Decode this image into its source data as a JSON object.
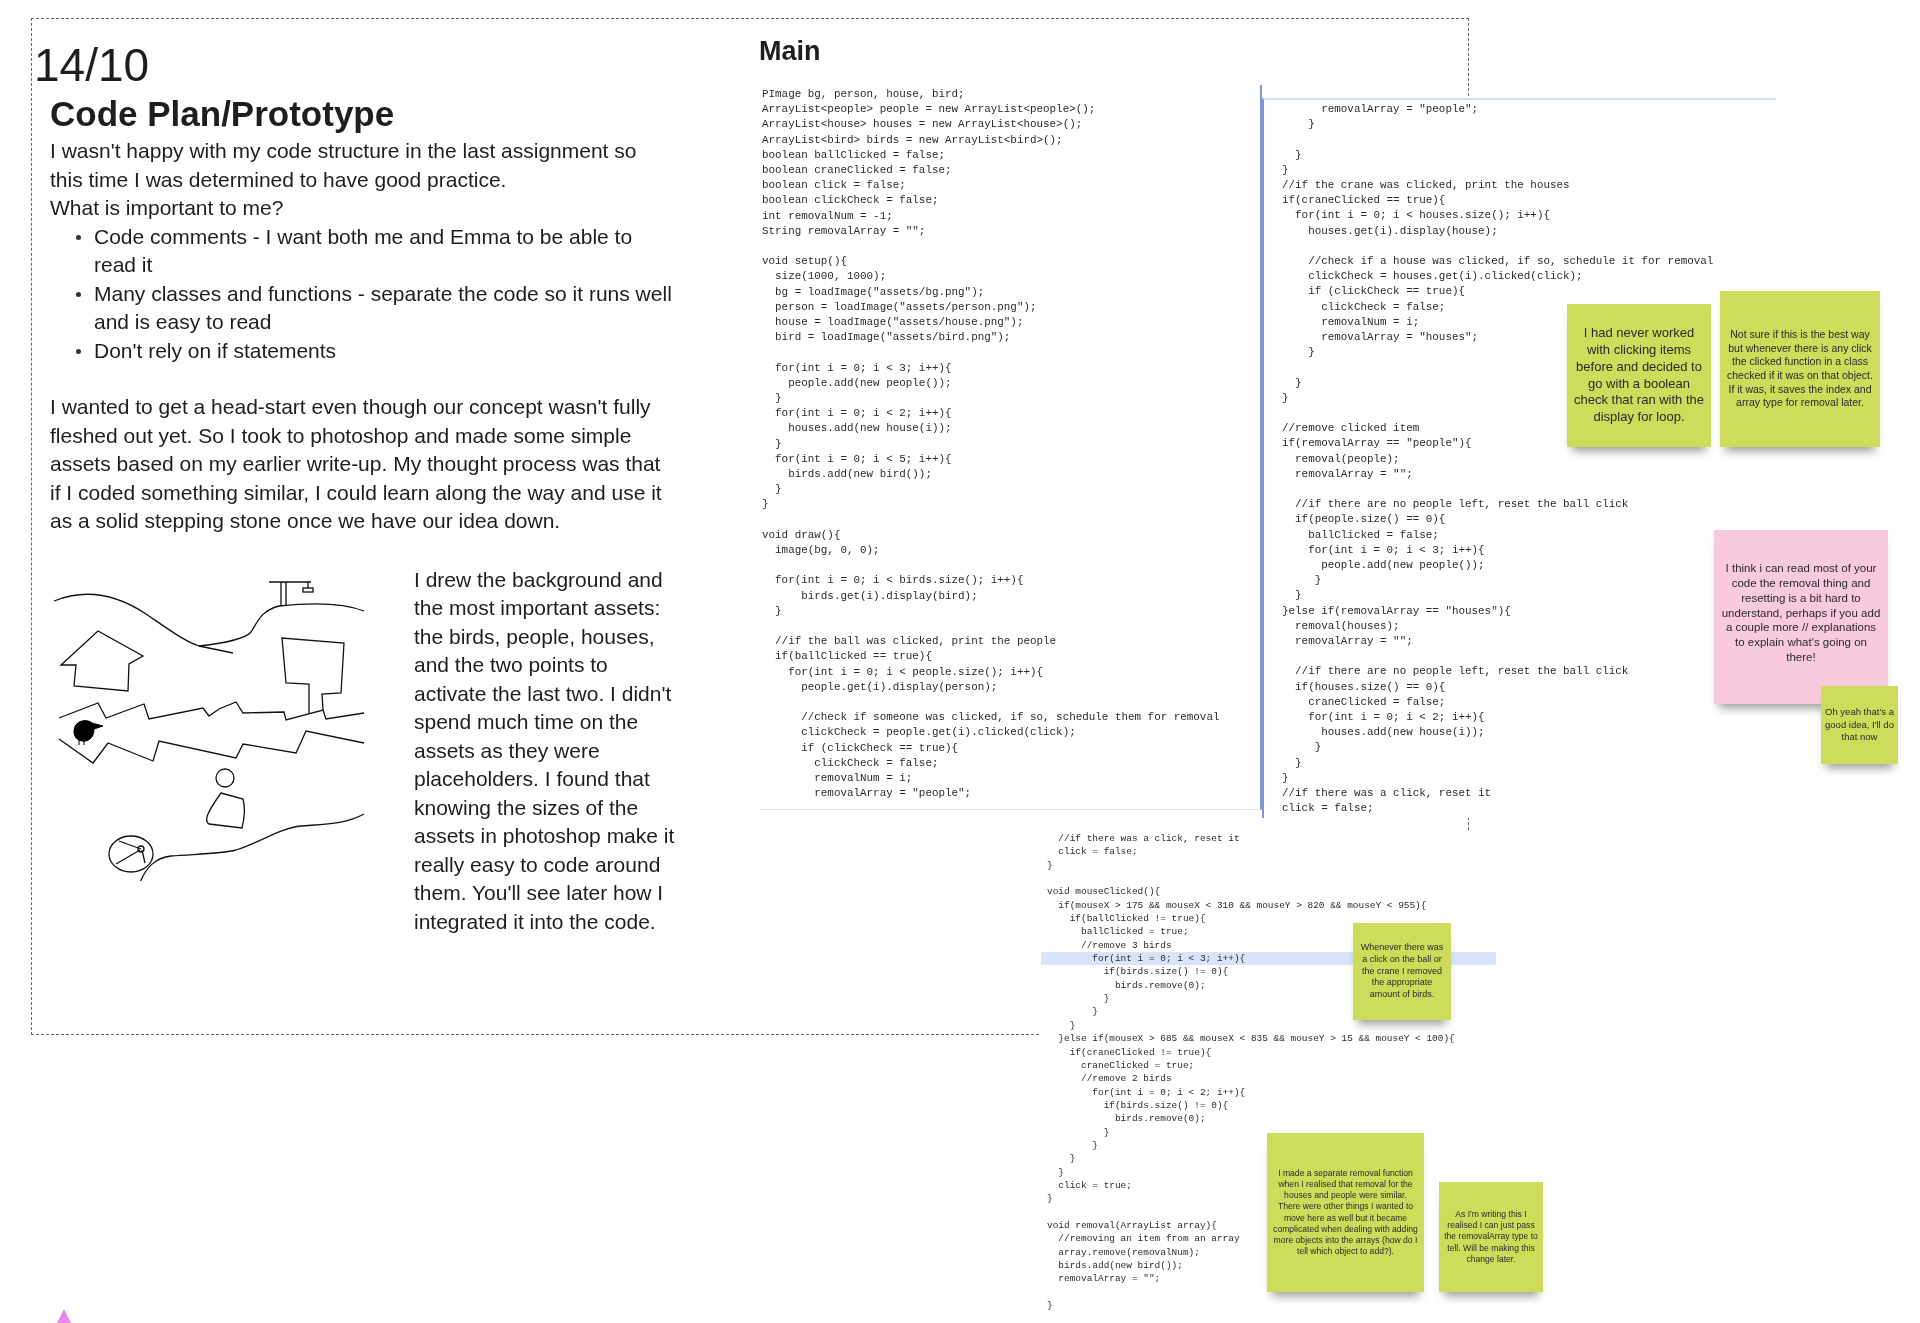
{
  "board": {
    "date": "14/10",
    "title": "Code Plan/Prototype",
    "intro": [
      "I wasn't happy with my code structure in the last assignment so this time I was determined to have good practice.",
      "What is important to me?"
    ],
    "bullets": [
      "Code comments - I want both me and Emma to be able to read it",
      "Many classes and functions - separate the code so it runs well and is easy to read",
      "Don't rely on if statements"
    ],
    "paragraph": "I wanted to get a head-start even though our concept wasn't fully fleshed out yet. So I took to photoshop and made some simple assets based on my earlier write-up. My thought process was that if I coded something similar, I could learn along the way and use it as a solid stepping stone once we have our idea down.",
    "sketch_caption": "I drew the background and the most important assets: the birds, people, houses, and the two points to activate the last two. I didn't spend much time on the assets as they were placeholders. I found that knowing the sizes of the assets in photoshop make it really easy to code around them. You'll see later how I integrated it into the code."
  },
  "code_section": {
    "heading": "Main",
    "blocks": [
      {
        "chunks": [
          {
            "gap_before": false,
            "highlighted": false,
            "lines": [
              "PImage bg, person, house, bird;",
              "ArrayList<people> people = new ArrayList<people>();",
              "ArrayList<house> houses = new ArrayList<house>();",
              "ArrayList<bird> birds = new ArrayList<bird>();",
              "boolean ballClicked = false;",
              "boolean craneClicked = false;",
              "boolean click = false;",
              "boolean clickCheck = false;",
              "int removalNum = -1;",
              "String removalArray = \"\";"
            ]
          },
          {
            "gap_before": true,
            "highlighted": false,
            "lines": [
              "void setup(){",
              "  size(1000, 1000);",
              "  bg = loadImage(\"assets/bg.png\");",
              "  person = loadImage(\"assets/person.png\");",
              "  house = loadImage(\"assets/house.png\");",
              "  bird = loadImage(\"assets/bird.png\");"
            ]
          },
          {
            "gap_before": true,
            "highlighted": false,
            "lines": [
              "  for(int i = 0; i < 3; i++){",
              "    people.add(new people());",
              "  }",
              "  for(int i = 0; i < 2; i++){",
              "    houses.add(new house(i));",
              "  }",
              "  for(int i = 0; i < 5; i++){",
              "    birds.add(new bird());",
              "  }",
              "}"
            ]
          },
          {
            "gap_before": true,
            "highlighted": false,
            "lines": [
              "void draw(){",
              "  image(bg, 0, 0);"
            ]
          },
          {
            "gap_before": true,
            "highlighted": false,
            "lines": [
              "  for(int i = 0; i < birds.size(); i++){",
              "      birds.get(i).display(bird);",
              "  }"
            ]
          },
          {
            "gap_before": true,
            "highlighted": false,
            "lines": [
              "  //if the ball was clicked, print the people",
              "  if(ballClicked == true){",
              "    for(int i = 0; i < people.size(); i++){",
              "      people.get(i).display(person);"
            ]
          },
          {
            "gap_before": true,
            "highlighted": false,
            "lines": [
              "      //check if someone was clicked, if so, schedule them for removal",
              "      clickCheck = people.get(i).clicked(click);",
              "      if (clickCheck == true){",
              "        clickCheck = false;",
              "        removalNum = i;",
              "        removalArray = \"people\";"
            ]
          }
        ]
      },
      {
        "chunks": [
          {
            "gap_before": false,
            "highlighted": false,
            "lines": [
              "      removalArray = \"people\";",
              "    }"
            ]
          },
          {
            "gap_before": true,
            "highlighted": false,
            "lines": [
              "  }",
              "}",
              "//if the crane was clicked, print the houses",
              "if(craneClicked == true){",
              "  for(int i = 0; i < houses.size(); i++){",
              "    houses.get(i).display(house);"
            ]
          },
          {
            "gap_before": true,
            "highlighted": false,
            "lines": [
              "    //check if a house was clicked, if so, schedule it for removal",
              "    clickCheck = houses.get(i).clicked(click);",
              "    if (clickCheck == true){",
              "      clickCheck = false;",
              "      removalNum = i;",
              "      removalArray = \"houses\";",
              "    }"
            ]
          },
          {
            "gap_before": true,
            "highlighted": false,
            "lines": [
              "  }",
              "}"
            ]
          },
          {
            "gap_before": true,
            "highlighted": false,
            "lines": [
              "//remove clicked item",
              "if(removalArray == \"people\"){",
              "  removal(people);",
              "  removalArray = \"\";"
            ]
          },
          {
            "gap_before": true,
            "highlighted": false,
            "lines": [
              "  //if there are no people left, reset the ball click",
              "  if(people.size() == 0){",
              "    ballClicked = false;",
              "    for(int i = 0; i < 3; i++){",
              "      people.add(new people());",
              "     }",
              "  }",
              "}else if(removalArray == \"houses\"){",
              "  removal(houses);",
              "  removalArray = \"\";"
            ]
          },
          {
            "gap_before": true,
            "highlighted": false,
            "lines": [
              "  //if there are no people left, reset the ball click",
              "  if(houses.size() == 0){",
              "    craneClicked = false;",
              "    for(int i = 0; i < 2; i++){",
              "      houses.add(new house(i));",
              "     }",
              "  }",
              "}",
              "//if there was a click, reset it",
              "click = false;"
            ]
          }
        ]
      },
      {
        "chunks": [
          {
            "gap_before": false,
            "highlighted": false,
            "lines": [
              "  //if there was a click, reset it",
              "  click = false;",
              "}"
            ]
          },
          {
            "gap_before": true,
            "highlighted": false,
            "lines": [
              "void mouseClicked(){",
              "  if(mouseX > 175 && mouseX < 310 && mouseY > 820 && mouseY < 955){",
              "    if(ballClicked != true){",
              "      ballClicked = true;",
              "      //remove 3 birds"
            ]
          },
          {
            "gap_before": false,
            "highlighted": true,
            "lines": [
              "        for(int i = 0; i < 3; i++){"
            ]
          },
          {
            "gap_before": false,
            "highlighted": false,
            "lines": [
              "          if(birds.size() != 0){",
              "            birds.remove(0);",
              "          }",
              "        }",
              "    }",
              "  }else if(mouseX > 685 && mouseX < 835 && mouseY > 15 && mouseY < 100){",
              "    if(craneClicked != true){",
              "      craneClicked = true;",
              "      //remove 2 birds",
              "        for(int i = 0; i < 2; i++){",
              "          if(birds.size() != 0){",
              "            birds.remove(0);",
              "          }",
              "        }",
              "    }",
              "  }",
              "  click = true;",
              "}"
            ]
          },
          {
            "gap_before": true,
            "highlighted": false,
            "lines": [
              "void removal(ArrayList array){",
              "  //removing an item from an array",
              "  array.remove(removalNum);",
              "  birds.add(new bird());",
              "  removalArray = \"\";"
            ]
          },
          {
            "gap_before": true,
            "highlighted": false,
            "lines": [
              "}"
            ]
          }
        ]
      }
    ]
  },
  "sticky_notes": [
    {
      "text": "I had never worked with clicking items before and decided to go with a boolean check that ran with the display for loop.",
      "color": "#cddc5b"
    },
    {
      "text": "Not sure if this is the best way but whenever there is any click the clicked function in a class checked if it was on that object. If it was, it saves the index and array type for removal later.",
      "color": "#cddc5b"
    },
    {
      "text": "I think i can read most of your code the removal thing and resetting is a bit hard to understand, perhaps if you add a couple more // explanations to explain what's going on there!",
      "color": "#f9cadd"
    },
    {
      "text": "Oh yeah that's a good idea, I'll do that now",
      "color": "#cddc5b"
    },
    {
      "text": "Whenever there was a click on the ball or the crane I removed the appropriate amount of birds.",
      "color": "#cddc5b"
    },
    {
      "text": "I made a separate removal function when I realised that removal for the houses and people were similar. There were other things I wanted to move here as well but it became complicated when dealing with adding more objects into the arrays (how do I tell which object to add?).",
      "color": "#cddc5b"
    },
    {
      "text": "As I'm writing this I realised I can just pass the removalArray type to tell. Will be making this change later.",
      "color": "#cddc5b"
    }
  ]
}
